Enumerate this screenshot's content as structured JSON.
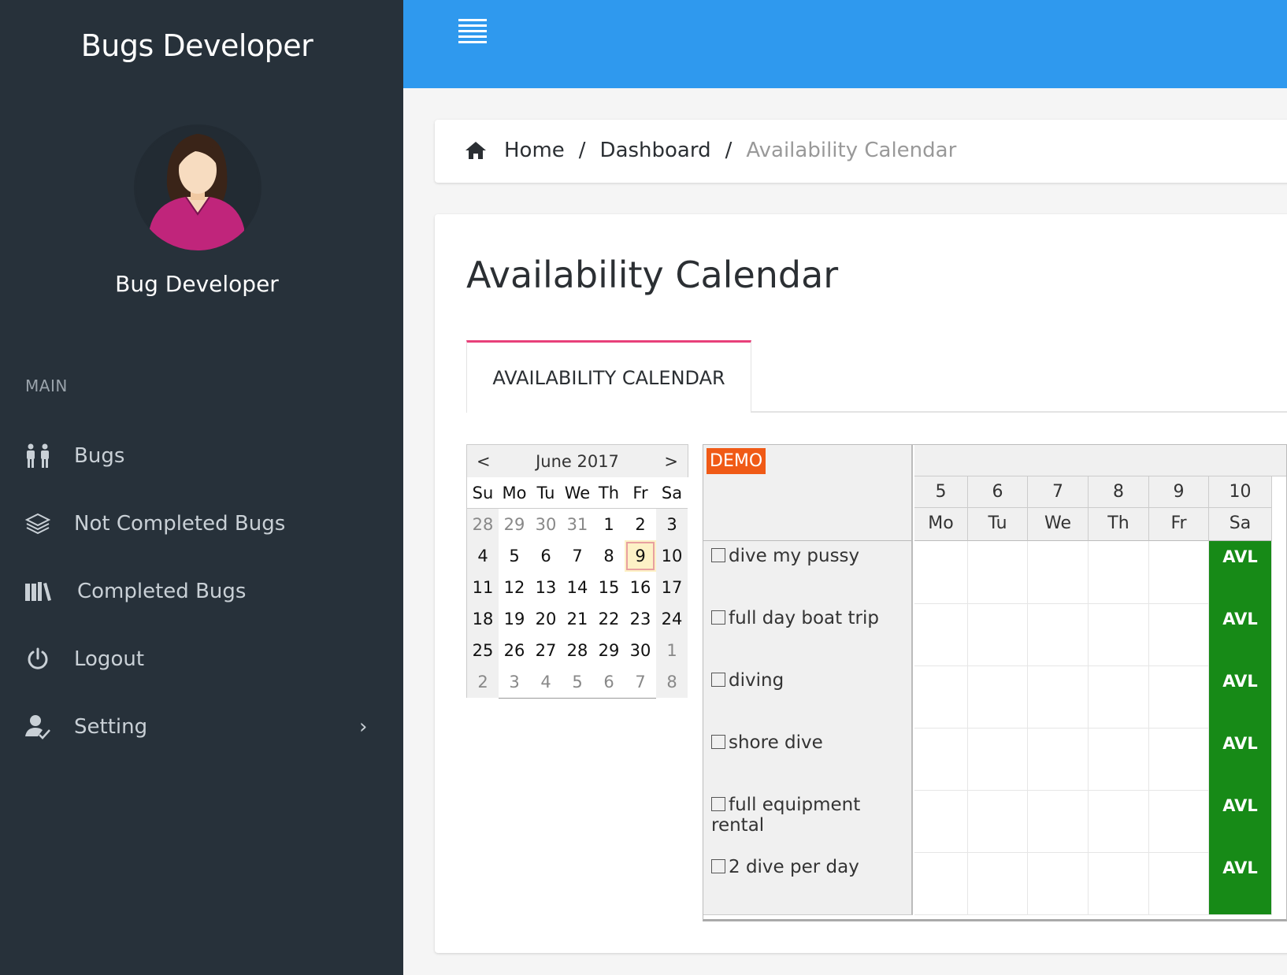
{
  "app": {
    "brand": "Bugs Developer",
    "user_name": "Bug Developer"
  },
  "sidebar": {
    "section_label": "MAIN",
    "items": [
      {
        "label": "Bugs",
        "icon": "people-icon"
      },
      {
        "label": "Not Completed Bugs",
        "icon": "layers-icon"
      },
      {
        "label": "Completed Bugs",
        "icon": "books-icon"
      },
      {
        "label": "Logout",
        "icon": "power-icon"
      },
      {
        "label": "Setting",
        "icon": "user-check-icon",
        "chevron": "›"
      }
    ]
  },
  "topbar": {
    "color": "#2f99ee"
  },
  "breadcrumb": {
    "home": "Home",
    "dashboard": "Dashboard",
    "current": "Availability Calendar",
    "separator": "/"
  },
  "page": {
    "title": "Availability Calendar",
    "tab_label": "AVAILABILITY CALENDAR"
  },
  "mini_calendar": {
    "month_label": "June 2017",
    "prev": "<",
    "next": ">",
    "weekday_headers": [
      "Su",
      "Mo",
      "Tu",
      "We",
      "Th",
      "Fr",
      "Sa"
    ],
    "weeks": [
      [
        "28",
        "29",
        "30",
        "31",
        "1",
        "2",
        "3"
      ],
      [
        "4",
        "5",
        "6",
        "7",
        "8",
        "9",
        "10"
      ],
      [
        "11",
        "12",
        "13",
        "14",
        "15",
        "16",
        "17"
      ],
      [
        "18",
        "19",
        "20",
        "21",
        "22",
        "23",
        "24"
      ],
      [
        "25",
        "26",
        "27",
        "28",
        "29",
        "30",
        "1"
      ],
      [
        "2",
        "3",
        "4",
        "5",
        "6",
        "7",
        "8"
      ]
    ],
    "selected_day": "9"
  },
  "scheduler": {
    "badge": "DEMO",
    "days": [
      {
        "num": "5",
        "dow": "Mo"
      },
      {
        "num": "6",
        "dow": "Tu"
      },
      {
        "num": "7",
        "dow": "We"
      },
      {
        "num": "8",
        "dow": "Th"
      },
      {
        "num": "9",
        "dow": "Fr"
      },
      {
        "num": "10",
        "dow": "Sa"
      }
    ],
    "rows": [
      {
        "label": "dive my pussy",
        "cells": [
          "",
          "",
          "",
          "",
          "",
          "AVL"
        ]
      },
      {
        "label": "full day boat trip",
        "cells": [
          "",
          "",
          "",
          "",
          "",
          "AVL"
        ]
      },
      {
        "label": "diving",
        "cells": [
          "",
          "",
          "",
          "",
          "",
          "AVL"
        ]
      },
      {
        "label": "shore dive",
        "cells": [
          "",
          "",
          "",
          "",
          "",
          "AVL"
        ]
      },
      {
        "label": "full equipment rental",
        "cells": [
          "",
          "",
          "",
          "",
          "",
          "AVL"
        ]
      },
      {
        "label": "2 dive per day",
        "cells": [
          "",
          "",
          "",
          "",
          "",
          "AVL"
        ]
      }
    ],
    "available_color": "#178a17"
  }
}
